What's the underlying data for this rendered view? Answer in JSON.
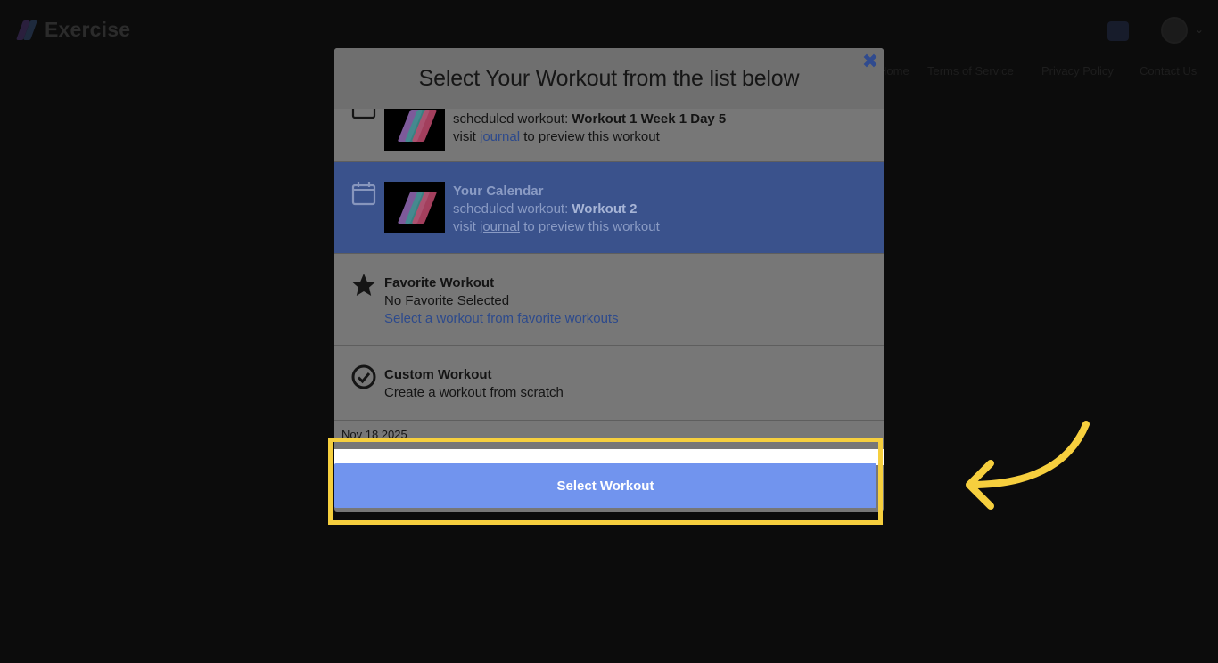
{
  "app": {
    "name": "Exercise"
  },
  "nav": [
    "Home",
    "Terms of Service",
    "Privacy Policy",
    "Contact Us"
  ],
  "modal": {
    "title": "Select Your Workout from the list below",
    "items": [
      {
        "title": "",
        "line1_prefix": "scheduled workout: ",
        "line1_value": "Workout 1 Week 1 Day 5",
        "line2_prefix": "visit ",
        "line2_link": "journal",
        "line2_suffix": " to preview this workout"
      },
      {
        "title": "Your Calendar",
        "line1_prefix": "scheduled workout: ",
        "line1_value": "Workout 2",
        "line2_prefix": "visit ",
        "line2_link": "journal",
        "line2_suffix": " to preview this workout",
        "selected": true
      },
      {
        "title": "Favorite Workout",
        "line1": "No Favorite Selected",
        "link": "Select a workout from favorite workouts"
      },
      {
        "title": "Custom Workout",
        "line1": "Create a workout from scratch"
      }
    ],
    "date": "Nov 18 2025",
    "select_button": "Select Workout"
  },
  "colors": {
    "accent": "#7194ee",
    "selected_row": "#3a528c",
    "highlight": "#f6cf3e",
    "link": "#2d4a8c"
  },
  "icons": [
    "close-icon",
    "calendar-icon",
    "star-icon",
    "check-circle-icon",
    "arrow-icon"
  ]
}
